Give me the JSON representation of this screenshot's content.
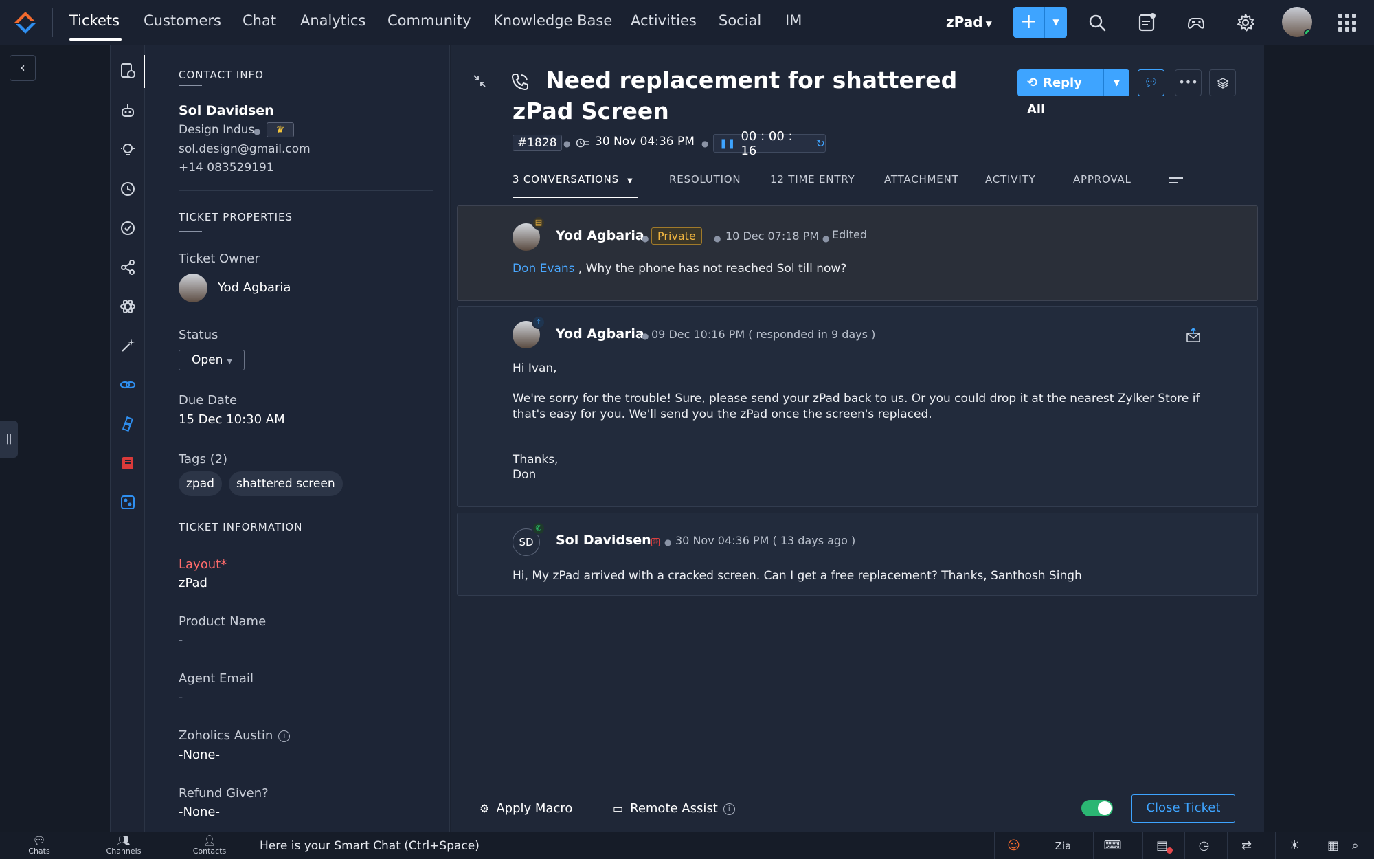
{
  "nav": {
    "items": [
      "Tickets",
      "Customers",
      "Chat",
      "Analytics",
      "Community",
      "Knowledge Base",
      "Activities",
      "Social",
      "IM"
    ],
    "department": "zPad"
  },
  "contact": {
    "section_title": "CONTACT INFO",
    "name": "Sol Davidsen",
    "company": "Design Indus",
    "email": "sol.design@gmail.com",
    "phone": "+14 083529191"
  },
  "properties": {
    "section_title": "TICKET PROPERTIES",
    "owner_label": "Ticket Owner",
    "owner_name": "Yod Agbaria",
    "status_label": "Status",
    "status_value": "Open",
    "due_label": "Due Date",
    "due_value": "15 Dec 10:30 AM",
    "tags_label": "Tags (2)",
    "tags": [
      "zpad",
      "shattered screen"
    ]
  },
  "information": {
    "section_title": "TICKET INFORMATION",
    "layout_label": "Layout",
    "layout_required": "*",
    "layout_value": "zPad",
    "product_label": "Product Name",
    "product_value": "-",
    "agent_email_label": "Agent Email",
    "agent_email_value": "-",
    "zoholics_label": "Zoholics Austin",
    "zoholics_value": "-None-",
    "refund_label": "Refund Given?",
    "refund_value": "-None-"
  },
  "ticket": {
    "title": "Need replacement for shattered zPad Screen",
    "id": "#1828",
    "created": "30 Nov 04:36 PM",
    "timer": "00 : 00 : 16",
    "reply_all": "Reply All"
  },
  "tabs": [
    "3 CONVERSATIONS",
    "RESOLUTION",
    "12 TIME ENTRY",
    "ATTACHMENT",
    "ACTIVITY",
    "APPROVAL"
  ],
  "conversations": [
    {
      "author": "Yod Agbaria",
      "badge": "Private",
      "time": "10 Dec 07:18 PM",
      "edited": "Edited",
      "mention": "Don Evans",
      "body": " , Why the phone has not reached Sol till now?"
    },
    {
      "author": "Yod Agbaria",
      "time": "09 Dec 10:16 PM ( responded in 9 days )",
      "greeting": "Hi Ivan,",
      "body": "We're sorry for the trouble! Sure, please send your zPad back to us. Or you could drop it at the nearest Zylker Store if that's easy for you. We'll send you the zPad once the screen's replaced.",
      "signoff": "Thanks,",
      "signature": "Don"
    },
    {
      "author": "Sol Davidsen",
      "initials": "SD",
      "time": "30 Nov 04:36 PM ( 13 days ago )",
      "body": "Hi, My zPad arrived with a cracked screen. Can I get a free replacement? Thanks, Santhosh Singh"
    }
  ],
  "actions": {
    "apply_macro": "Apply Macro",
    "remote_assist": "Remote Assist",
    "close_ticket": "Close Ticket"
  },
  "bottombar": {
    "chats": "Chats",
    "channels": "Channels",
    "contacts": "Contacts",
    "smart_chat": "Here is your Smart Chat (Ctrl+Space)"
  },
  "colors": {
    "accent": "#3ea4ff",
    "background": "#1b2230",
    "private": "#f1b640",
    "online": "#29c46a"
  }
}
